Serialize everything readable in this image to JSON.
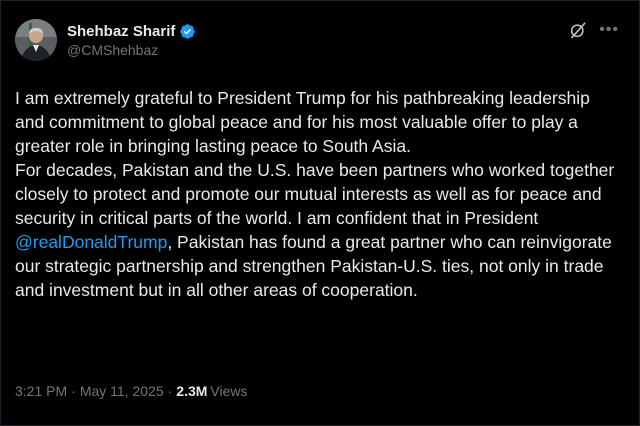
{
  "author": {
    "display_name": "Shehbaz Sharif",
    "handle": "@CMShehbaz",
    "verified_icon": "verified-badge-icon",
    "avatar": "profile-photo"
  },
  "header_actions": {
    "grok_icon": "grok-icon",
    "more_icon": "more-options-icon"
  },
  "tweet": {
    "text_part1": "I am extremely grateful to President Trump for his pathbreaking leadership and commitment to global peace and for his most valuable offer to play a greater role in bringing lasting peace to South Asia.\nFor decades, Pakistan and the U.S. have been partners who worked together closely to protect and promote our mutual interests as well as for peace and security in critical parts of the world. I am confident that in President ",
    "mention": "@realDonaldTrump",
    "text_part2": ", Pakistan has found a great partner who can reinvigorate our strategic partnership and strengthen Pakistan-U.S. ties, not only in trade and investment but in all other areas of cooperation."
  },
  "meta": {
    "time": "3:21 PM",
    "date": "May 11, 2025",
    "separator": "·",
    "views_count": "2.3M",
    "views_label": "Views"
  },
  "colors": {
    "background": "#000000",
    "text": "#e7e9ea",
    "muted": "#71767b",
    "link": "#1d9bf0",
    "verified": "#1d9bf0"
  }
}
